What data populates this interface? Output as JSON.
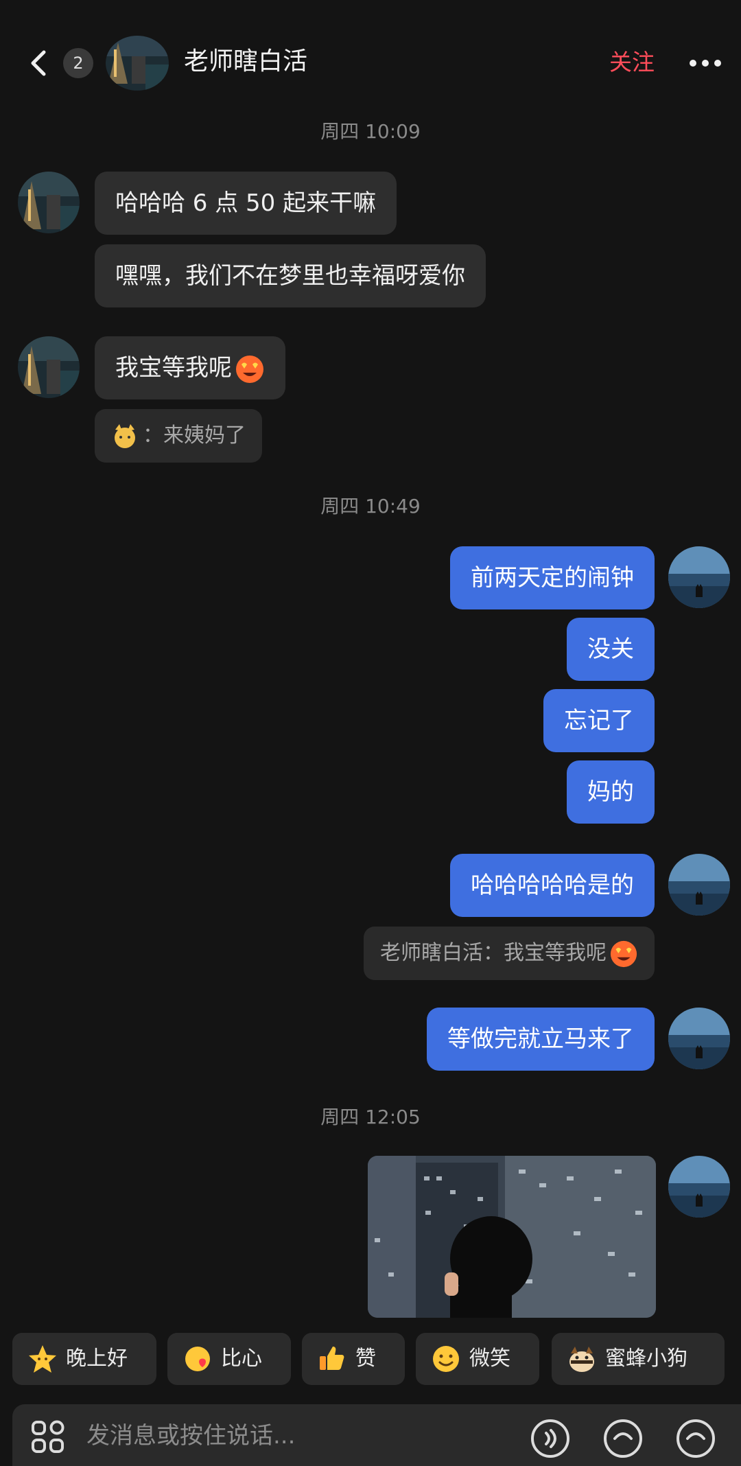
{
  "header": {
    "unread_count": "2",
    "title": "老师瞎白活",
    "follow_label": "关注"
  },
  "messages": {
    "ts1": "周四 10:09",
    "m1": "哈哈哈 6 点 50 起来干嘛",
    "m2": "嘿嘿，我们不在梦里也幸福呀爱你",
    "m3": "我宝等我呢",
    "q1_sep": "：",
    "q1_text": "来姨妈了",
    "ts2": "周四 10:49",
    "r1": "前两天定的闹钟",
    "r2": "没关",
    "r3": "忘记了",
    "r4": "妈的",
    "r5": "哈哈哈哈哈是的",
    "q2_text": "老师瞎白活：我宝等我呢",
    "r6": "等做完就立马来了",
    "ts3": "周四 12:05"
  },
  "quick_replies": [
    {
      "label": "晚上好",
      "icon": "star-face-icon"
    },
    {
      "label": "比心",
      "icon": "finger-heart-icon"
    },
    {
      "label": "赞",
      "icon": "thumbs-up-icon"
    },
    {
      "label": "微笑",
      "icon": "smile-icon"
    },
    {
      "label": "蜜蜂小狗",
      "icon": "bee-dog-icon"
    }
  ],
  "input": {
    "placeholder": "发消息或按住说话..."
  },
  "colors": {
    "background": "#141414",
    "outgoing_bubble": "#3f6fe0",
    "incoming_bubble": "#2e2e2e",
    "follow": "#ff4d5a"
  }
}
